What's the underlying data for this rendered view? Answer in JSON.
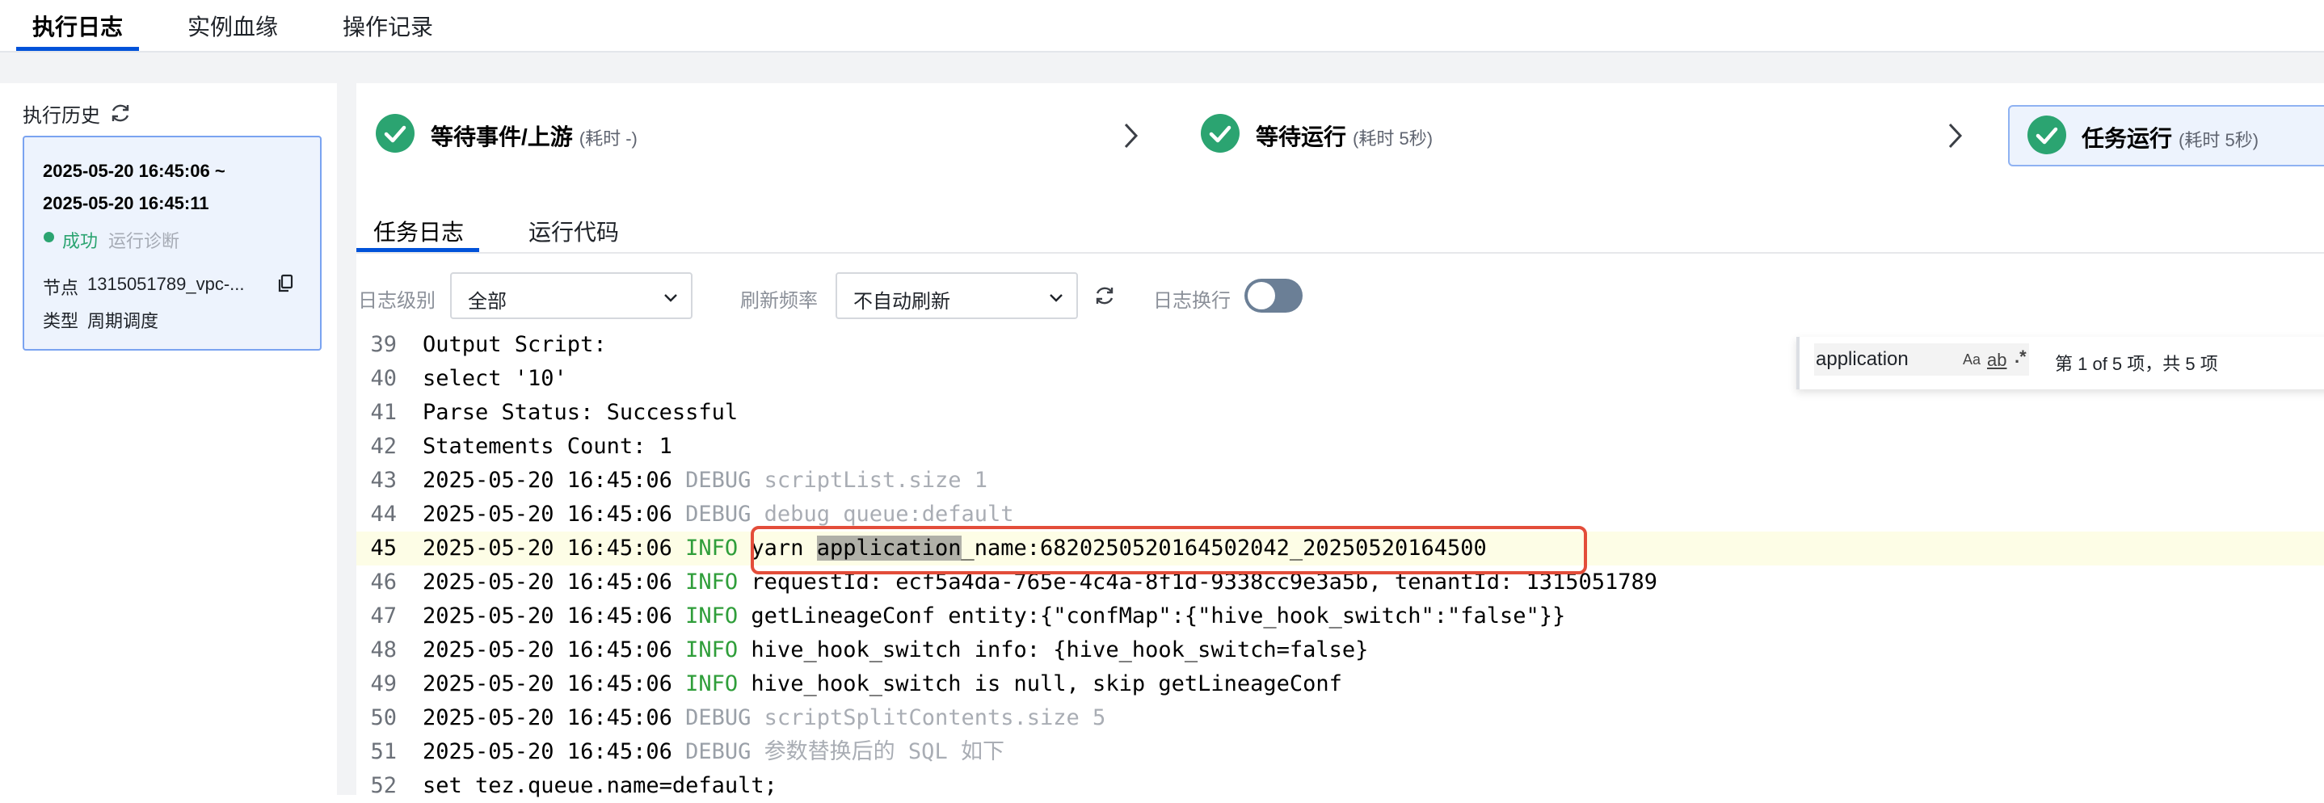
{
  "top_tabs": [
    "执行日志",
    "实例血缘",
    "操作记录"
  ],
  "history": {
    "title": "执行历史",
    "card": {
      "time_start": "2025-05-20 16:45:06 ~",
      "time_end": "2025-05-20 16:45:11",
      "status": "成功",
      "diagnose": "运行诊断",
      "node_label": "节点",
      "node_value": "1315051789_vpc-...",
      "type_label": "类型",
      "type_value": "周期调度"
    }
  },
  "steps": [
    {
      "title": "等待事件/上游",
      "duration": "(耗时 -)"
    },
    {
      "title": "等待运行",
      "duration": "(耗时 5秒)"
    },
    {
      "title": "任务运行",
      "duration": "(耗时 5秒)"
    }
  ],
  "sub_tabs": [
    "任务日志",
    "运行代码"
  ],
  "controls": {
    "log_level_label": "日志级别",
    "log_level_value": "全部",
    "refresh_label": "刷新频率",
    "refresh_value": "不自动刷新",
    "wrap_label": "日志换行",
    "wrap_enabled": false
  },
  "search": {
    "query": "application",
    "opt_case": "Aa",
    "opt_word": "ab",
    "opt_regex": ".*",
    "count": "第 1 of 5 项，共 5 项"
  },
  "log": {
    "current_line": 45,
    "lines": [
      {
        "n": "39",
        "ts": "",
        "level": "",
        "msg": "Output Script:"
      },
      {
        "n": "40",
        "ts": "",
        "level": "",
        "msg": "select '10'"
      },
      {
        "n": "41",
        "ts": "",
        "level": "",
        "msg": "Parse Status: Successful"
      },
      {
        "n": "42",
        "ts": "",
        "level": "",
        "msg": "Statements Count: 1"
      },
      {
        "n": "43",
        "ts": "2025-05-20 16:45:06",
        "level": "DEBUG",
        "msg": "scriptList.size 1"
      },
      {
        "n": "44",
        "ts": "2025-05-20 16:45:06",
        "level": "DEBUG",
        "msg": "debug queue:default"
      },
      {
        "n": "45",
        "ts": "2025-05-20 16:45:06",
        "level": "INFO",
        "msg_pre": "yarn ",
        "msg_match": "application",
        "msg_post": "_name:6820250520164502042_20250520164500"
      },
      {
        "n": "46",
        "ts": "2025-05-20 16:45:06",
        "level": "INFO",
        "msg": "requestId: ecf5a4da-765e-4c4a-8f1d-9338cc9e3a5b, tenantId: 1315051789"
      },
      {
        "n": "47",
        "ts": "2025-05-20 16:45:06",
        "level": "INFO",
        "msg": "getLineageConf entity:{\"confMap\":{\"hive_hook_switch\":\"false\"}}"
      },
      {
        "n": "48",
        "ts": "2025-05-20 16:45:06",
        "level": "INFO",
        "msg": "hive_hook_switch info: {hive_hook_switch=false}"
      },
      {
        "n": "49",
        "ts": "2025-05-20 16:45:06",
        "level": "INFO",
        "msg": "hive_hook_switch is null, skip getLineageConf"
      },
      {
        "n": "50",
        "ts": "2025-05-20 16:45:06",
        "level": "DEBUG",
        "msg": "scriptSplitContents.size 5"
      },
      {
        "n": "51",
        "ts": "2025-05-20 16:45:06",
        "level": "DEBUG",
        "msg": "参数替换后的 SQL 如下"
      },
      {
        "n": "52",
        "ts": "",
        "level": "",
        "msg": "set tez.queue.name=default;"
      }
    ]
  },
  "colors": {
    "accent": "#0052d9",
    "success": "#2ba471",
    "info_level": "#2f9e3a",
    "debug_level": "#9aa0a8",
    "annotation": "#e34d3a"
  }
}
